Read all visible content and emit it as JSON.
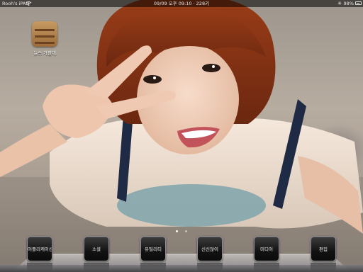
{
  "status_bar": {
    "carrier": "Rooh's iPAD",
    "wifi_icon": "wifi-icon",
    "time": "09/09 오후 09:10 · 228키",
    "bluetooth_glyph": "✳",
    "battery_level": "98%",
    "battery_icon": "battery-icon"
  },
  "home_icons": [
    {
      "label": "뉴스 가판대",
      "icon": "newsstand-icon"
    }
  ],
  "page_indicator": {
    "pages": 2,
    "current": 1
  },
  "dock": {
    "items": [
      {
        "label": "어플리케이션"
      },
      {
        "label": "소셜"
      },
      {
        "label": "유틸리티"
      },
      {
        "label": "신신많이"
      },
      {
        "label": "미디어"
      },
      {
        "label": "편집"
      }
    ]
  },
  "wallpaper": {
    "subject": "photo",
    "colors": {
      "hair": "#7a2f14",
      "skin": "#f1d1bd",
      "shirt": "#f3e3d5",
      "strap": "#1f2a44"
    }
  }
}
